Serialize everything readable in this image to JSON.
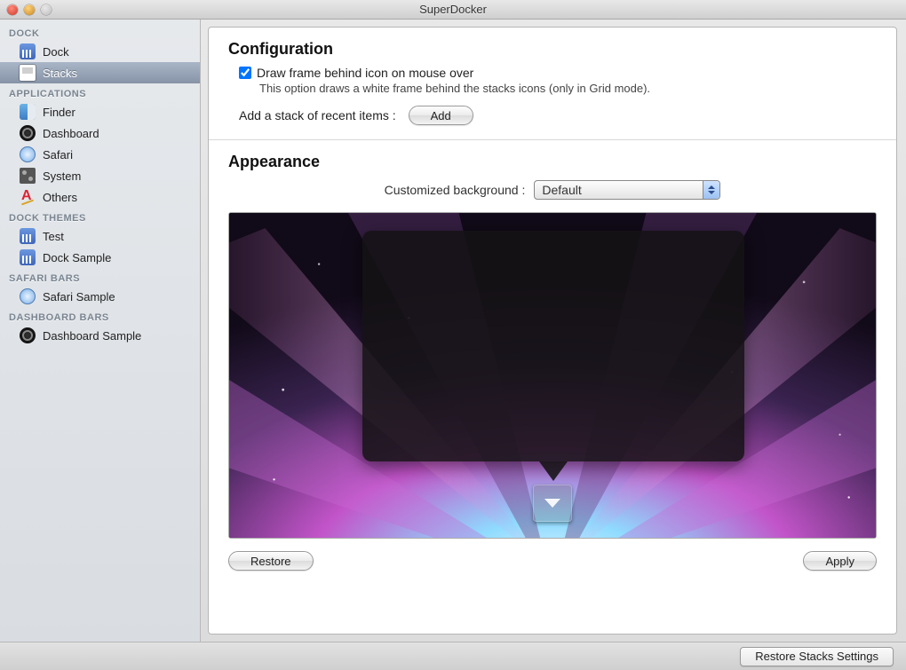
{
  "window": {
    "title": "SuperDocker"
  },
  "sidebar": {
    "groups": [
      {
        "label": "DOCK",
        "items": [
          {
            "label": "Dock",
            "iconClass": "ic-dock",
            "iconName": "dock-icon",
            "selected": false
          },
          {
            "label": "Stacks",
            "iconClass": "ic-stacks",
            "iconName": "stacks-icon",
            "selected": true
          }
        ]
      },
      {
        "label": "APPLICATIONS",
        "items": [
          {
            "label": "Finder",
            "iconClass": "ic-finder",
            "iconName": "finder-icon"
          },
          {
            "label": "Dashboard",
            "iconClass": "ic-dashboard",
            "iconName": "dashboard-icon"
          },
          {
            "label": "Safari",
            "iconClass": "ic-safari",
            "iconName": "safari-icon"
          },
          {
            "label": "System",
            "iconClass": "ic-system",
            "iconName": "system-icon"
          },
          {
            "label": "Others",
            "iconClass": "ic-others",
            "iconName": "others-icon"
          }
        ]
      },
      {
        "label": "DOCK THEMES",
        "items": [
          {
            "label": "Test",
            "iconClass": "ic-dock",
            "iconName": "dock-icon"
          },
          {
            "label": "Dock Sample",
            "iconClass": "ic-dock",
            "iconName": "dock-icon"
          }
        ]
      },
      {
        "label": "SAFARI BARS",
        "items": [
          {
            "label": "Safari Sample",
            "iconClass": "ic-safari",
            "iconName": "safari-icon"
          }
        ]
      },
      {
        "label": "DASHBOARD BARS",
        "items": [
          {
            "label": "Dashboard Sample",
            "iconClass": "ic-dashboard",
            "iconName": "dashboard-icon"
          }
        ]
      }
    ]
  },
  "content": {
    "config_heading": "Configuration",
    "draw_frame_label": "Draw frame behind icon on mouse over",
    "draw_frame_checked": true,
    "draw_frame_desc": "This option draws a white frame behind the stacks icons (only in Grid mode).",
    "add_recent_label": "Add a stack of recent items :",
    "add_button": "Add",
    "appearance_heading": "Appearance",
    "bg_label": "Customized background :",
    "bg_selected": "Default",
    "restore_button": "Restore",
    "apply_button": "Apply"
  },
  "bottom": {
    "restore_stacks": "Restore Stacks Settings"
  }
}
